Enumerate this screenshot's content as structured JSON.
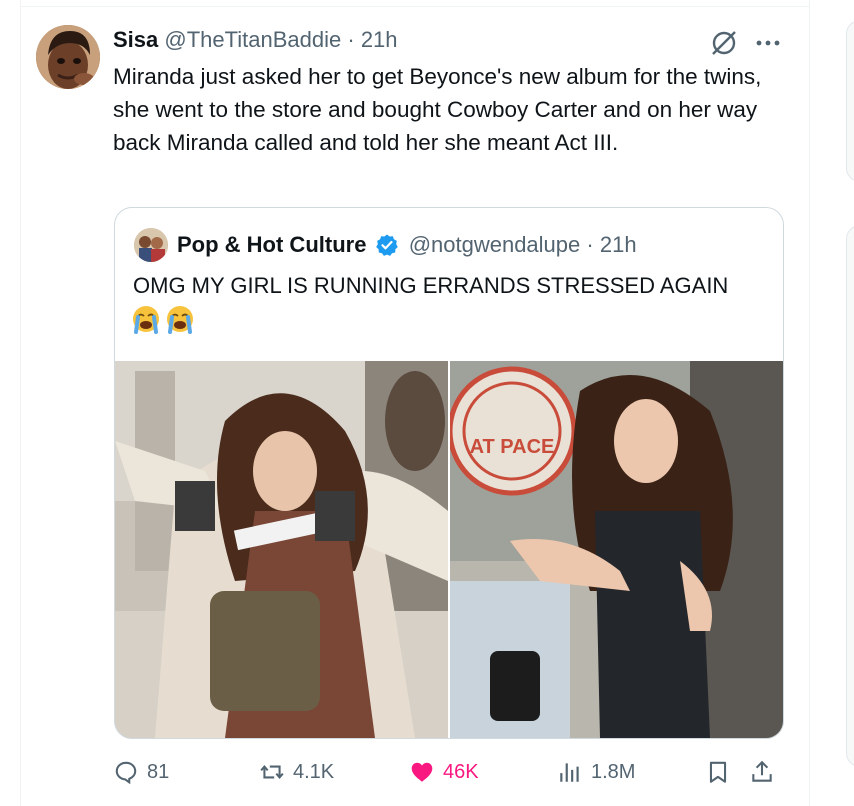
{
  "tweet": {
    "author": {
      "display_name": "Sisa",
      "handle": "@TheTitanBaddie",
      "separator": "·",
      "time": "21h"
    },
    "text": "Miranda just asked her to get Beyonce's new album for the twins, she went to the store and bought Cowboy Carter and on her way back Miranda called and told her she meant Act III.",
    "icons": {
      "grok": "grok-icon",
      "more": "more-dots-icon"
    },
    "quote": {
      "display_name": "Pop & Hot Culture",
      "handle": "@notgwendalupe",
      "separator": "·",
      "time": "21h",
      "verified": true,
      "text": "OMG MY GIRL IS RUNNING ERRANDS STRESSED AGAIN",
      "emojis": [
        "loudly-crying-face",
        "loudly-crying-face"
      ],
      "photo_sign_text": "AT PACE"
    },
    "actions": {
      "replies": "81",
      "reposts": "4.1K",
      "likes": "46K",
      "views": "1.8M"
    }
  },
  "colors": {
    "text": "#0f1419",
    "muted": "#536471",
    "like": "#f91880",
    "verified": "#1d9bf0",
    "border": "#cfd9de"
  }
}
